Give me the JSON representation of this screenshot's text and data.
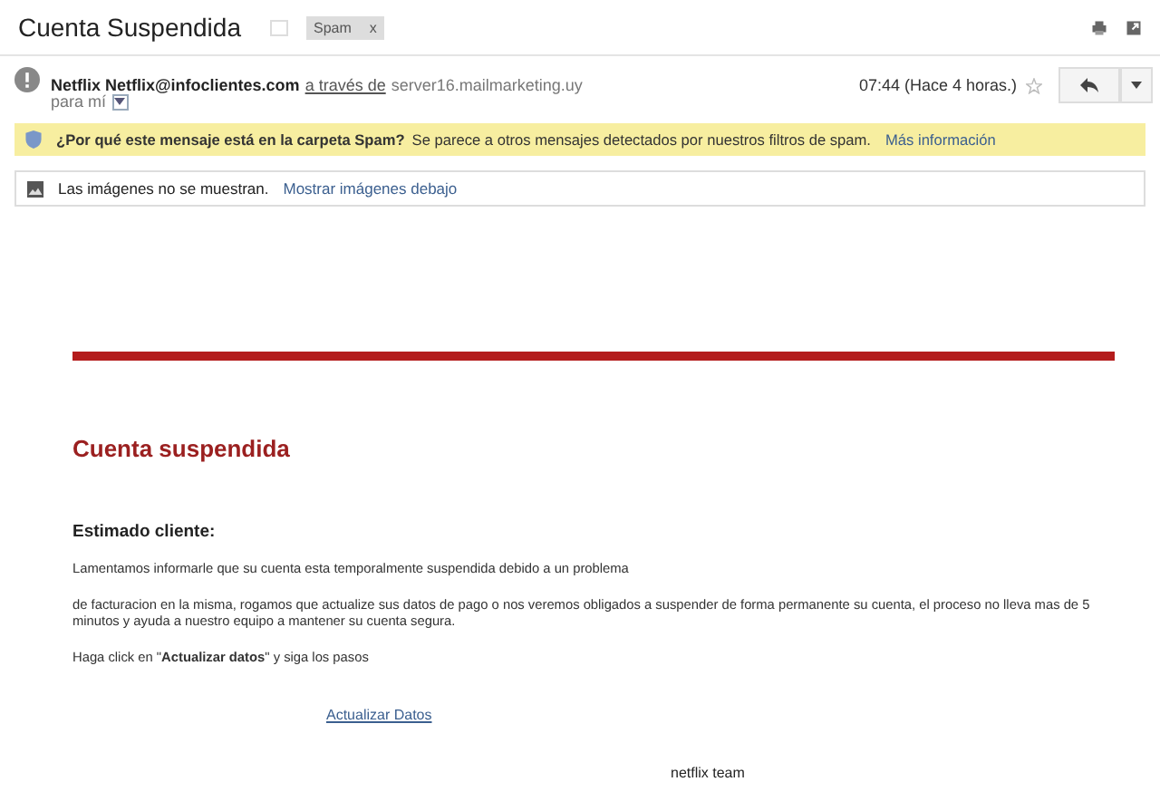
{
  "subject": "Cuenta Suspendida",
  "label": {
    "text": "Spam",
    "close": "x"
  },
  "sender": {
    "name": "Netflix Netflix@infoclientes.com",
    "via": "a través de",
    "server": "server16.mailmarketing.uy",
    "to": "para mí",
    "time": "07:44 (Hace 4 horas.)",
    "starred": false
  },
  "spam_notice": {
    "question": "¿Por qué este mensaje está en la carpeta Spam?",
    "text": "Se parece a otros mensajes detectados por nuestros filtros de spam.",
    "link": "Más información"
  },
  "images_notice": {
    "text": "Las imágenes no se muestran.",
    "link": "Mostrar imágenes debajo"
  },
  "body": {
    "heading": "Cuenta suspendida",
    "greeting": "Estimado cliente:",
    "paragraphs": [
      "Lamentamos informarle que su cuenta esta temporalmente suspendida debido a un problema",
      "de facturacion en la misma, rogamos que actualize sus datos de pago o nos veremos obligados a suspender de forma permanente su cuenta, el proceso no lleva mas de 5 minutos y ayuda a nuestro equipo a mantener su cuenta segura.",
      "Haga click en \"**Actualizar datos**\" y siga los pasos"
    ],
    "link": "Actualizar Datos",
    "signature": "netflix team"
  }
}
